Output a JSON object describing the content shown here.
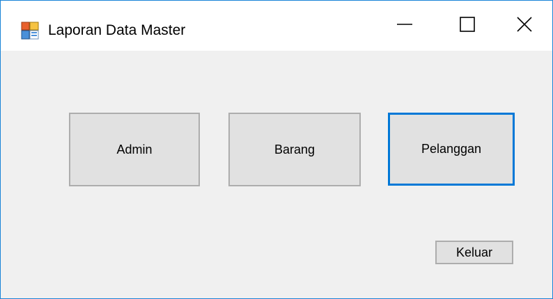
{
  "window": {
    "title": "Laporan Data Master",
    "icon": "form-app-icon",
    "controls": {
      "minimize_icon": "minimize-icon",
      "maximize_icon": "maximize-icon",
      "close_icon": "close-icon"
    }
  },
  "buttons": {
    "admin": "Admin",
    "barang": "Barang",
    "pelanggan": "Pelanggan",
    "keluar": "Keluar"
  },
  "colors": {
    "title_bar": "#ffffff",
    "form_background": "#f0f0f0",
    "button_face": "#e1e1e1",
    "button_border": "#adadad",
    "focus_accent": "#0078d7",
    "window_border": "#1883d7"
  }
}
